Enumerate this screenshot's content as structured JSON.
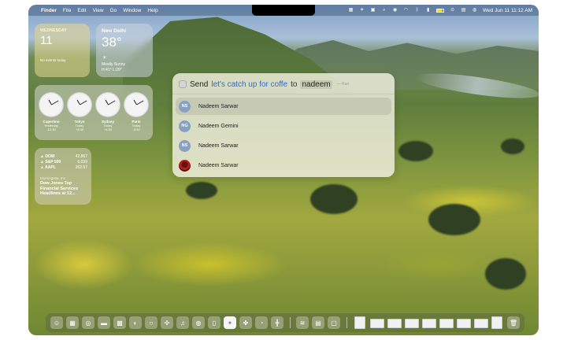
{
  "menubar": {
    "apple_icon": "apple-icon",
    "items": [
      "Finder",
      "File",
      "Edit",
      "View",
      "Go",
      "Window",
      "Help"
    ],
    "datetime": "Wed Jun 11  11:12 AM"
  },
  "widgets": {
    "calendar": {
      "weekday": "WEDNESDAY",
      "date": "11",
      "empty_text": "No events today"
    },
    "weather": {
      "city": "New Delhi",
      "temp": "38°",
      "condition": "Mostly Sunny",
      "hilo": "H:41° L:29°",
      "icon": "sun-icon"
    },
    "clocks": [
      {
        "city": "Cupertino",
        "day": "Yesterday",
        "offset": "-12:30"
      },
      {
        "city": "Tokyo",
        "day": "Today",
        "offset": "+3:30"
      },
      {
        "city": "Sydney",
        "day": "Today",
        "offset": "+4:30"
      },
      {
        "city": "Paris",
        "day": "Today",
        "offset": "-3:30"
      }
    ],
    "stocks": {
      "rows": [
        {
          "symbol": "▲ DOW",
          "value": "42,867"
        },
        {
          "symbol": "▲ S&P 500",
          "value": "6,039"
        },
        {
          "symbol": "▲ AAPL",
          "value": "202.67"
        }
      ],
      "source": "Morningstar, Inc.",
      "headline": "Dow Jones Top Financial Services Headlines at 12..."
    }
  },
  "spotlight": {
    "verb": "Send",
    "message": "let's catch up for coffe",
    "to": "to",
    "recipient": "nadeem",
    "run_hint": "— Run",
    "results": [
      {
        "initials": "NS",
        "name": "Nadeem Sarwar"
      },
      {
        "initials": "NG",
        "name": "Nadeem Gemini"
      },
      {
        "initials": "NS",
        "name": "Nadeem Sarwar"
      },
      {
        "initials": "",
        "name": "Nadeem Sarwar"
      }
    ]
  },
  "dock": {
    "apps": [
      "finder-icon",
      "launchpad-icon",
      "safari-icon",
      "photos-icon",
      "messages-icon",
      "mail-icon",
      "chrome-icon",
      "slack-icon",
      "music-icon",
      "podcasts-icon",
      "notes-icon",
      "spotlight-icon",
      "shortcuts-icon",
      "activity-monitor-icon",
      "keynote-icon",
      "spotify-icon",
      "preview-icon",
      "photo-booth-icon"
    ],
    "trash_icon": "trash-icon"
  }
}
